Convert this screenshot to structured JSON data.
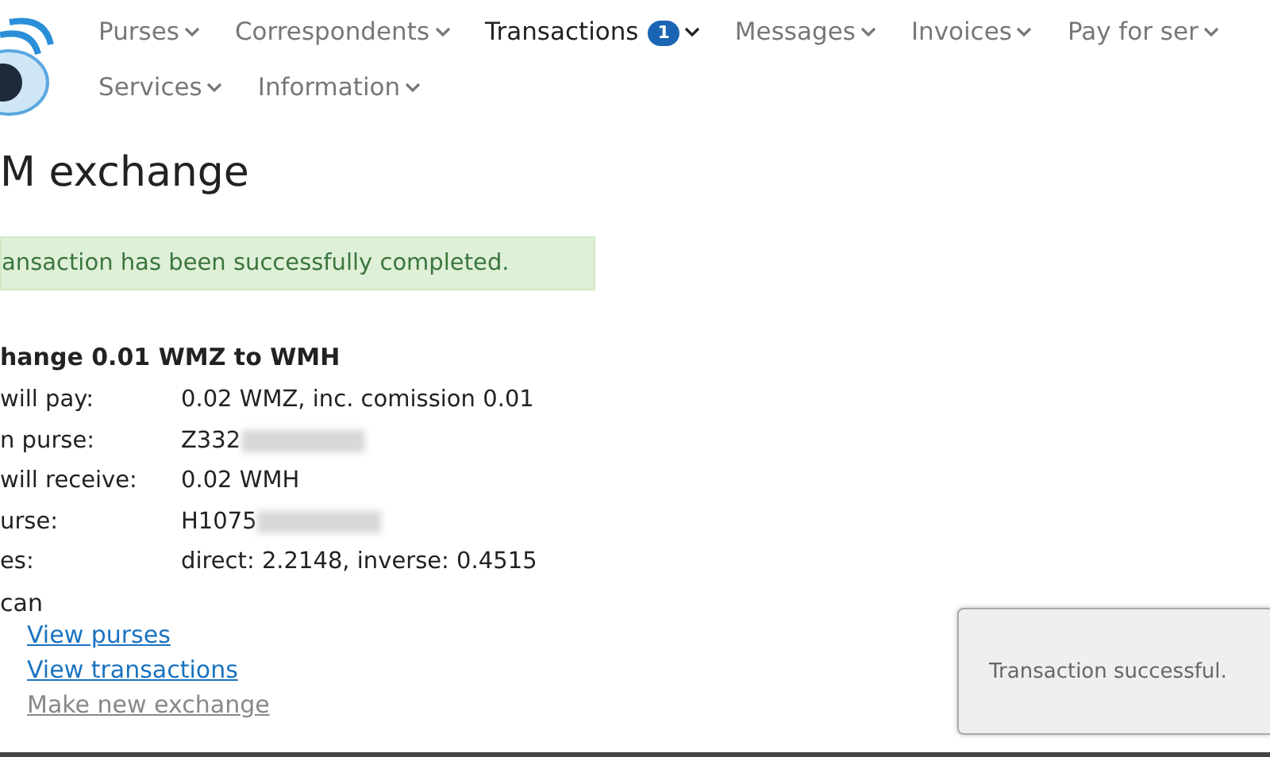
{
  "nav_rows": [
    [
      {
        "label": "Purses",
        "selected": false
      },
      {
        "label": "Correspondents",
        "selected": false
      },
      {
        "label": "Transactions",
        "selected": true,
        "badge": "1"
      },
      {
        "label": "Messages",
        "selected": false
      },
      {
        "label": "Invoices",
        "selected": false
      },
      {
        "label": "Pay for ser",
        "selected": false
      }
    ],
    [
      {
        "label": "Services",
        "selected": false
      },
      {
        "label": "Information",
        "selected": false
      }
    ]
  ],
  "title": "M exchange",
  "alert": "ansaction has been successfully completed.",
  "heading": "hange 0.01 WMZ to WMH",
  "details": [
    {
      "label": "will pay:",
      "value": "0.02 WMZ, inc. comission 0.01",
      "redacted": false
    },
    {
      "label": "n purse:",
      "value": "Z332",
      "redacted": true
    },
    {
      "label": "will receive:",
      "value": "0.02 WMH",
      "redacted": false
    },
    {
      "label": "urse:",
      "value": "H1075",
      "redacted": true
    },
    {
      "label": "es:",
      "value": "direct: 2.2148, inverse: 0.4515",
      "redacted": false
    }
  ],
  "links_intro": "can",
  "links": [
    {
      "label": "View purses",
      "disabled": false
    },
    {
      "label": "View transactions",
      "disabled": false
    },
    {
      "label": "Make new exchange",
      "disabled": true
    }
  ],
  "toast": "Transaction successful."
}
